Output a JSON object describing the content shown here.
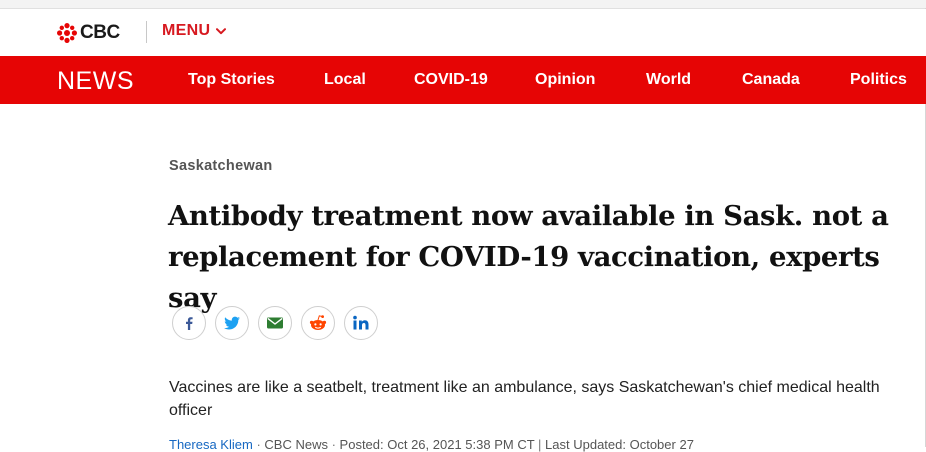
{
  "brand": {
    "logo_text": "CBC",
    "menu_label": "MENU"
  },
  "nav": {
    "news_label": "NEWS",
    "items": [
      {
        "label": "Top Stories"
      },
      {
        "label": "Local"
      },
      {
        "label": "COVID-19"
      },
      {
        "label": "Opinion"
      },
      {
        "label": "World"
      },
      {
        "label": "Canada"
      },
      {
        "label": "Politics"
      }
    ]
  },
  "article": {
    "section": "Saskatchewan",
    "headline": "Antibody treatment now available in Sask. not a replacement for COVID-19 vaccination, experts say",
    "deck": "Vaccines are like a seatbelt, treatment like an ambulance, says Saskatchewan's chief medical health officer",
    "byline": {
      "author": "Theresa Kliem",
      "source": "CBC News",
      "posted": "Posted: Oct 26, 2021 5:38 PM CT",
      "updated": "Last Updated: October 27"
    }
  },
  "share": {
    "icons": [
      "facebook-icon",
      "twitter-icon",
      "email-icon",
      "reddit-icon",
      "linkedin-icon"
    ]
  },
  "colors": {
    "brand_red": "#e60505",
    "menu_red": "#d71920",
    "facebook": "#3b5998",
    "twitter": "#1da1f2",
    "email": "#2e7d32",
    "reddit": "#ff4500",
    "linkedin": "#0a66c2"
  }
}
